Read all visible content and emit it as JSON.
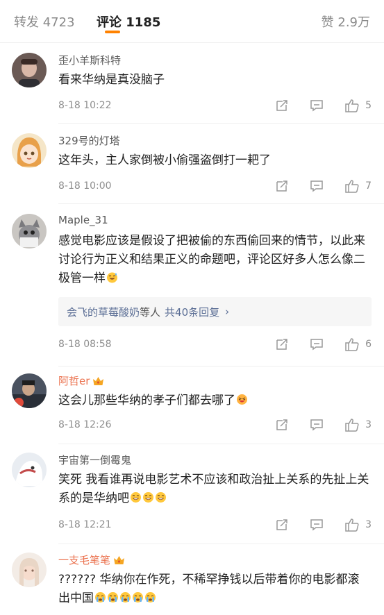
{
  "tabs": {
    "repost": "转发 4723",
    "comments": "评论 1185",
    "likes": "赞 2.9万"
  },
  "colors": {
    "accent": "#ff8200",
    "vip_name": "#eb7350",
    "link": "#5b6e95"
  },
  "comments": [
    {
      "user": "歪小羊斯科特",
      "text": "看来华纳是真没脑子",
      "time": "8-18 10:22",
      "likes": "5"
    },
    {
      "user": "329号的灯塔",
      "text": "这年头，主人家倒被小偷强盗倒打一耙了",
      "time": "8-18 10:00",
      "likes": "7"
    },
    {
      "user": "Maple_31",
      "text": "感觉电影应该是假设了把被偷的东西偷回来的情节，以此来讨论行为正义和结果正义的命题吧，评论区好多人怎么像二极管一样",
      "time": "8-18 08:58",
      "likes": "6",
      "replies": {
        "user": "会飞的草莓酸奶",
        "suffix": "等人",
        "count": "共40条回复",
        "arrow": "›"
      }
    },
    {
      "user": "阿哲er",
      "text": "这会儿那些华纳的孝子们都去哪了",
      "time": "8-18 12:26",
      "likes": "3"
    },
    {
      "user": "宇宙第一倒霉鬼",
      "text": "笑死 我看谁再说电影艺术不应该和政治扯上关系的先扯上关系的是华纳吧",
      "time": "8-18 12:21",
      "likes": "3"
    },
    {
      "user": "一支毛笔笔",
      "text": "?????? 华纳你在作死，不稀罕挣钱以后带着你的电影都滚出中国"
    }
  ]
}
